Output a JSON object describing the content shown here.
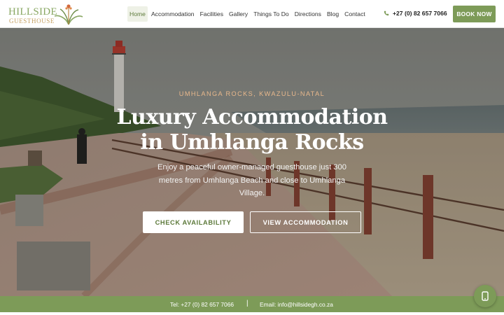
{
  "logo": {
    "line1": "HILLSIDE",
    "line2": "GUESTHOUSE"
  },
  "nav": {
    "items": [
      {
        "label": "Home",
        "active": true
      },
      {
        "label": "Accommodation"
      },
      {
        "label": "Facilities"
      },
      {
        "label": "Gallery"
      },
      {
        "label": "Things To Do"
      },
      {
        "label": "Directions"
      },
      {
        "label": "Blog"
      },
      {
        "label": "Contact"
      }
    ]
  },
  "header": {
    "phone": "+27 (0) 82 657 7066",
    "phone_icon": "phone-icon",
    "book_label": "BOOK NOW"
  },
  "hero": {
    "eyebrow": "UMHLANGA ROCKS, KWAZULU-NATAL",
    "title": "Luxury Accommodation in Umhlanga Rocks",
    "subtitle": "Enjoy a peaceful owner-managed guesthouse just 300 metres from Umhlanga Beach and close to Umhlanga Village.",
    "check_label": "CHECK AVAILABILITY",
    "view_label": "VIEW ACCOMMODATION"
  },
  "footer": {
    "tel": "Tel: +27 (0) 82 657 7066",
    "separator": "|",
    "email": "Email: info@hillsidegh.co.za"
  },
  "chat": {
    "icon": "whatsapp-icon"
  },
  "colors": {
    "brand_green": "#7d9b58",
    "accent_tan": "#c4a061",
    "eyebrow": "#e8b88c"
  }
}
